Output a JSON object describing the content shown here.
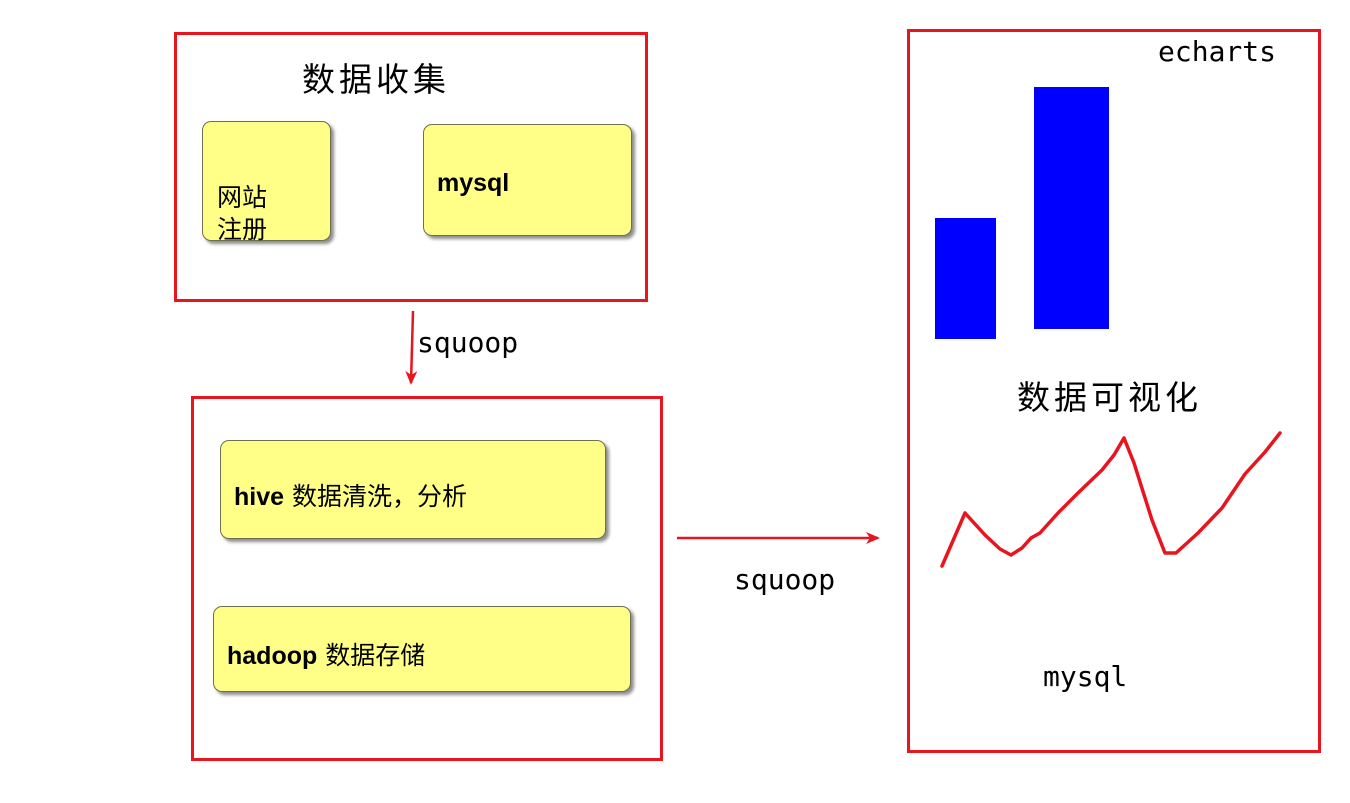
{
  "collect": {
    "title": "数据收集",
    "note_site": "网站\n注册",
    "note_mysql": "mysql"
  },
  "process": {
    "hive_keyword": "hive",
    "hive_desc": " 数据清洗，分析",
    "hadoop_keyword": "hadoop",
    "hadoop_desc": " 数据存储"
  },
  "arrows": {
    "down_label": "squoop",
    "right_label": "squoop"
  },
  "visual": {
    "echarts_label": "echarts",
    "title": "数据可视化",
    "mysql_label": "mysql"
  },
  "colors": {
    "frame": "#e8141e",
    "note_fill": "#ffff88",
    "bar": "#0000ff",
    "line": "#e8141e"
  }
}
